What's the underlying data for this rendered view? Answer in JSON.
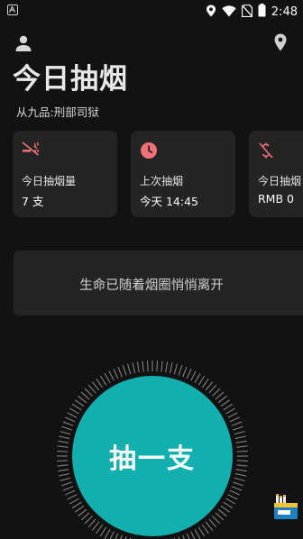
{
  "status_bar": {
    "time": "2:48",
    "icons": [
      "location-icon",
      "wifi-icon",
      "no-sim-icon",
      "battery-icon"
    ]
  },
  "header": {
    "title": "今日抽烟",
    "subtitle": "从九品:刑部司狱",
    "icons": [
      "user-icon",
      "location-pin-icon"
    ]
  },
  "stats": [
    {
      "label": "今日抽烟量",
      "value": "7 支",
      "icon": "no-smoking-icon"
    },
    {
      "label": "上次抽烟",
      "value": "今天 14:45",
      "icon": "clock-icon"
    },
    {
      "label": "今日抽烟",
      "value": "RMB 0",
      "icon": "money-off-icon"
    }
  ],
  "quote": "生命已随着烟圈悄悄离开",
  "action": {
    "smoke_button_label": "抽一支"
  },
  "colors": {
    "background": "#121212",
    "card": "#242424",
    "accent_red": "#f2707a",
    "button_teal": "#13aeae"
  }
}
